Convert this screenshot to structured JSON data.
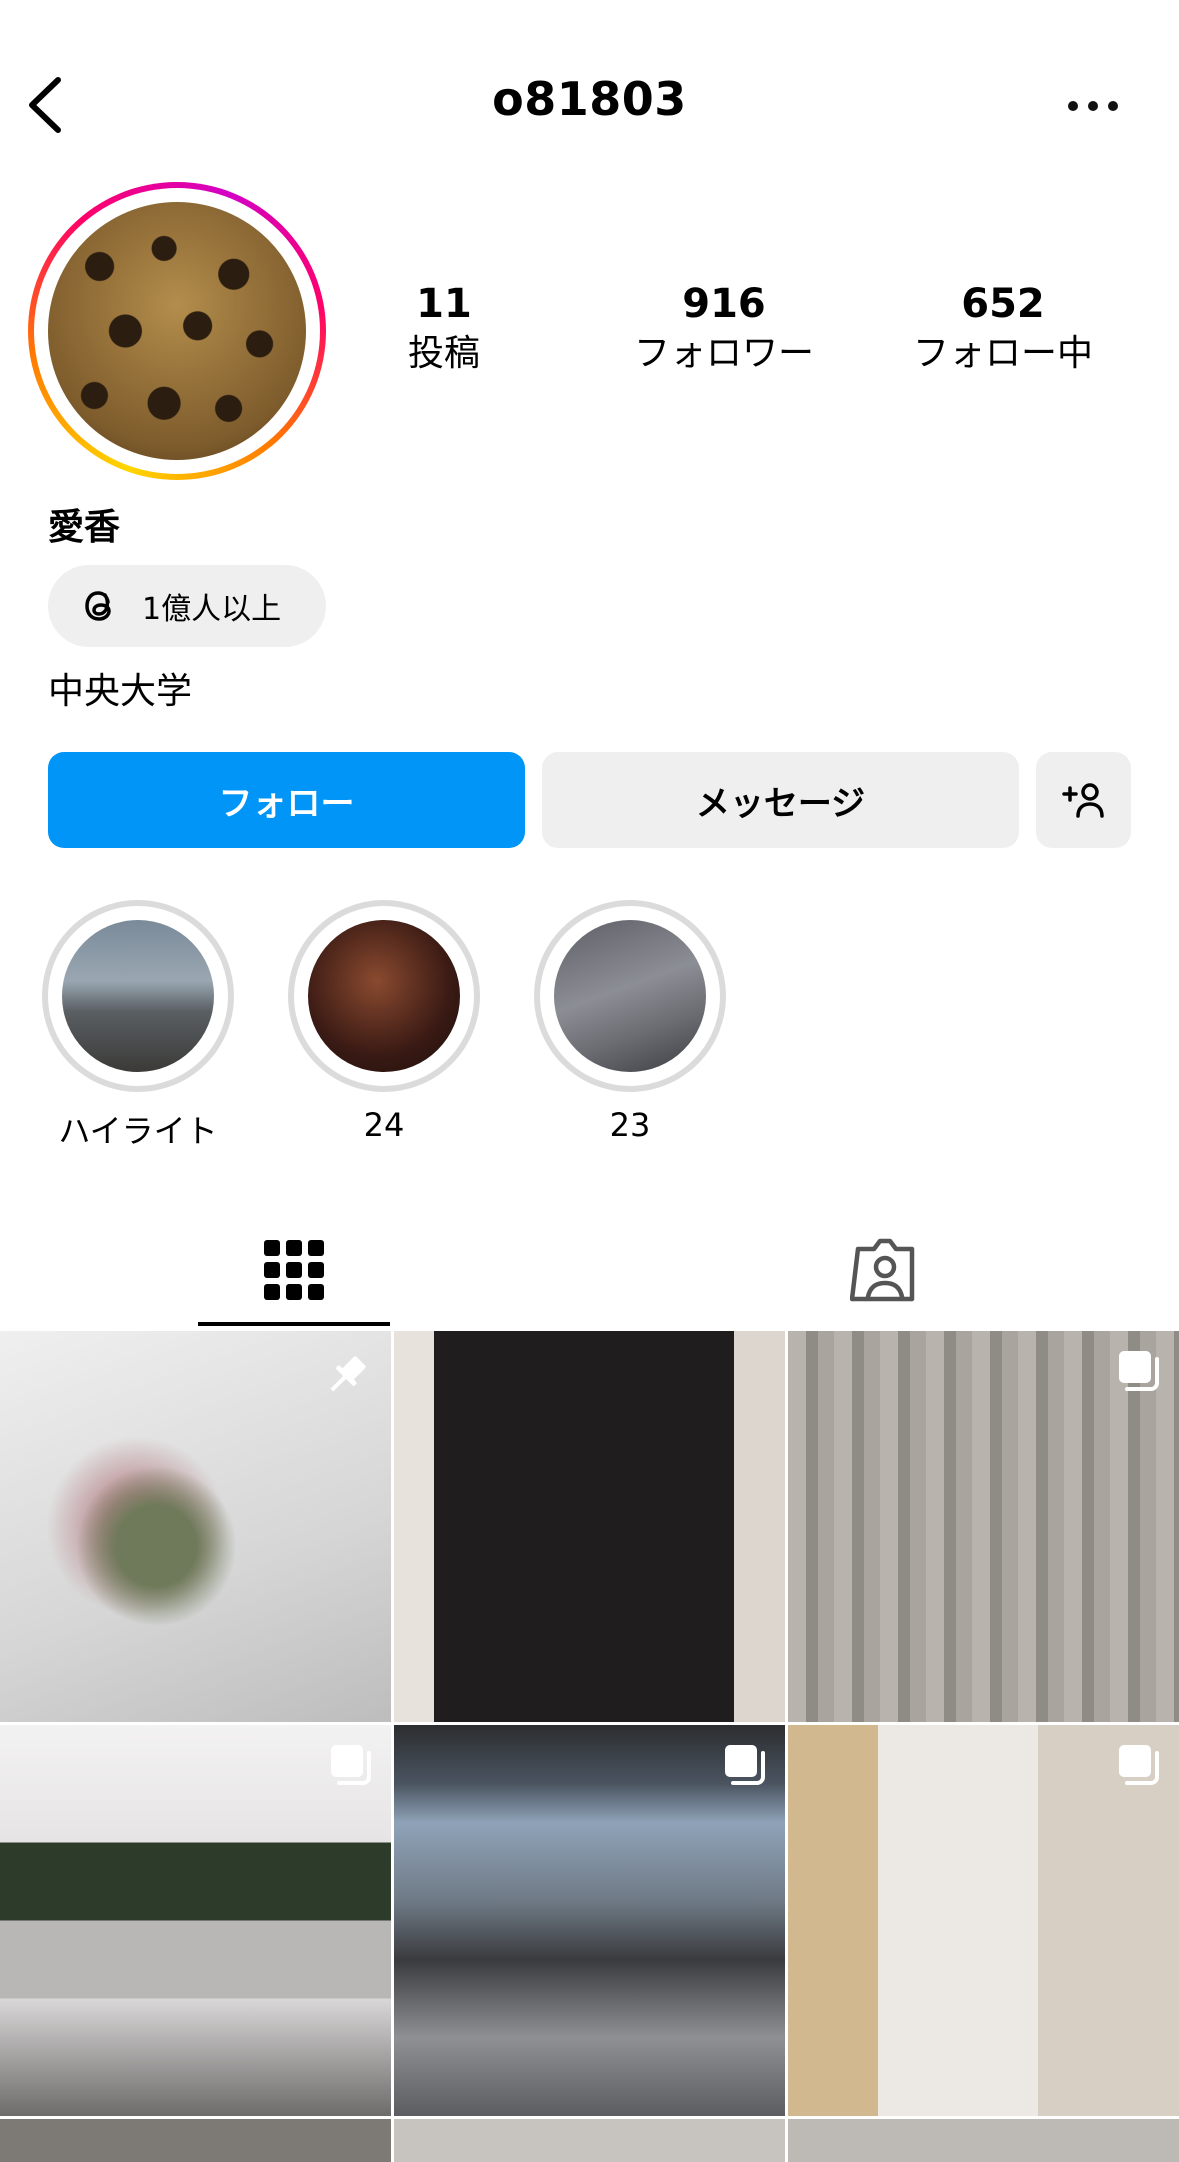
{
  "header": {
    "username": "o81803",
    "back_icon": "chevron-left-icon",
    "more_icon": "more-horizontal-icon"
  },
  "profile": {
    "stats": [
      {
        "value": "11",
        "label": "投稿"
      },
      {
        "value": "916",
        "label": "フォロワー"
      },
      {
        "value": "652",
        "label": "フォロー中"
      }
    ],
    "display_name": "愛香",
    "threads_badge": "1億人以上",
    "bio": "中央大学"
  },
  "actions": {
    "follow": "フォロー",
    "message": "メッセージ",
    "add_user_icon": "person-add-icon"
  },
  "highlights": [
    {
      "label": "ハイライト"
    },
    {
      "label": "24"
    },
    {
      "label": "23"
    }
  ],
  "tabs": [
    {
      "name": "posts-grid",
      "icon": "grid-icon",
      "selected": true
    },
    {
      "name": "tagged",
      "icon": "tagged-person-icon",
      "selected": false
    }
  ],
  "colors": {
    "primary": "#0095f6",
    "secondary_button": "#efefef",
    "story_ring_start": "#ffd600",
    "story_ring_end": "#d300c5"
  }
}
